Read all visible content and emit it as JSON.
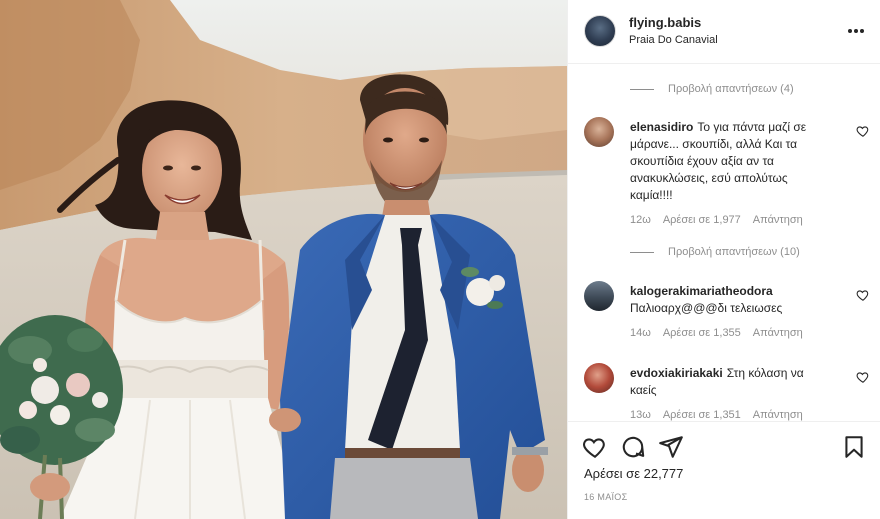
{
  "post": {
    "username": "flying.babis",
    "location": "Praia Do Canavial",
    "likes": "Αρέσει σε 22,777",
    "date": "16 ΜΑΪΟΣ",
    "photo_alt": "Wedding photo"
  },
  "comments": [
    {
      "view_replies": "Προβολή απαντήσεων (4)",
      "username": "elenasidiro",
      "text": "Το για πάντα μαζί σε μάρανε... σκουπίδι, αλλά Και τα σκουπίδια έχουν αξία αν τα ανακυκλώσεις, εσύ απολύτως καμία!!!!",
      "time": "12ω",
      "likes": "Αρέσει σε 1,977",
      "reply": "Απάντηση"
    },
    {
      "view_replies": "Προβολή απαντήσεων (10)",
      "username": "kalogerakimariatheodora",
      "text": "Παλιοαρχ@@@δι τελειωσες",
      "time": "14ω",
      "likes": "Αρέσει σε 1,355",
      "reply": "Απάντηση"
    },
    {
      "username": "evdoxiakiriakaki",
      "text": "Στη κόλαση να καείς",
      "time": "13ω",
      "likes": "Αρέσει σε 1,351",
      "reply": "Απάντηση"
    }
  ],
  "icons": {
    "more": "more-options-icon",
    "like": "heart-icon",
    "comment": "comment-icon",
    "share": "paper-plane-icon",
    "save": "bookmark-icon"
  },
  "colors": {
    "text": "#262626",
    "secondary": "#8e8e8e",
    "border": "#efefef",
    "jacket": "#2f5fa8"
  }
}
